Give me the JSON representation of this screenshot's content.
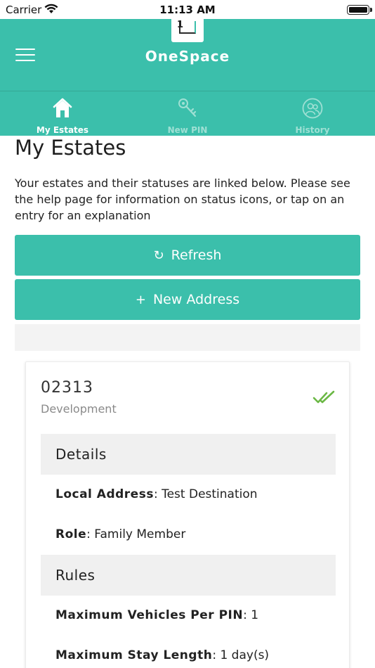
{
  "status_bar": {
    "carrier": "Carrier",
    "time": "11:13 AM"
  },
  "header": {
    "title": "OneSpace",
    "logo_text": "1",
    "menu_icon": "hamburger-menu-icon"
  },
  "tabs": [
    {
      "label": "My Estates",
      "icon": "home-icon",
      "active": true
    },
    {
      "label": "New PIN",
      "icon": "key-icon",
      "active": false
    },
    {
      "label": "History",
      "icon": "people-icon",
      "active": false
    }
  ],
  "main": {
    "title": "My Estates",
    "intro": "Your estates and their statuses are linked below. Please see the help page for information on status icons, or tap on an entry for an explanation",
    "refresh_label": "Refresh",
    "new_address_label": "New Address"
  },
  "estate": {
    "code": "02313",
    "name": "Development",
    "status_icon": "double-check-icon",
    "status_color": "#6bb845",
    "details_heading": "Details",
    "local_address_label": "Local Address",
    "local_address_value": "Test Destination",
    "role_label": "Role",
    "role_value": "Family Member",
    "rules_heading": "Rules",
    "max_vehicles_label": "Maximum Vehicles Per PIN",
    "max_vehicles_value": "1",
    "max_stay_label": "Maximum Stay Length",
    "max_stay_value": "1 day(s)"
  },
  "colors": {
    "brand": "#3bbfab",
    "inactive_tab": "#9fe0d4",
    "section_bg": "#f0f0f0"
  }
}
